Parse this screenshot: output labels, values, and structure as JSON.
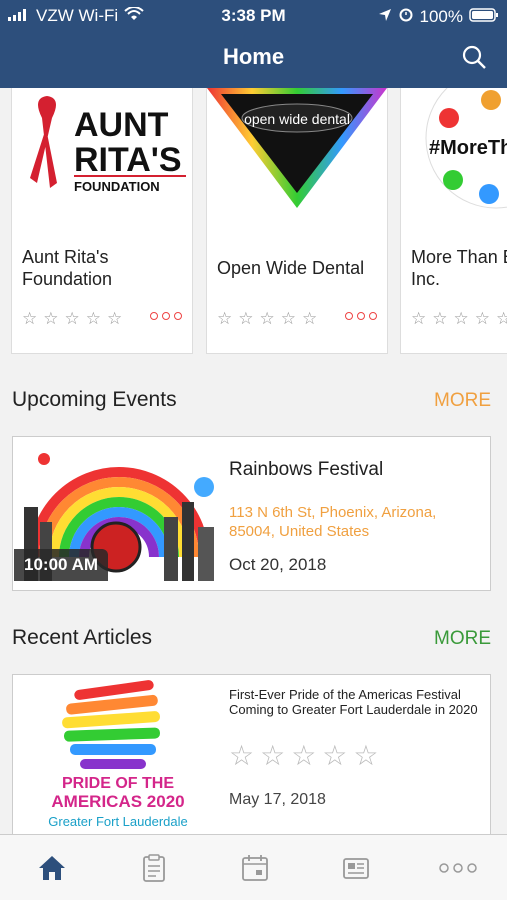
{
  "status_bar": {
    "carrier": "VZW Wi-Fi",
    "time": "3:38 PM",
    "battery": "100%"
  },
  "nav": {
    "title": "Home",
    "search_icon": "search-icon"
  },
  "organizations": [
    {
      "name": "Aunt Rita's Foundation",
      "logo_text_1": "AUNT",
      "logo_text_2": "RITA'S",
      "logo_text_3": "FOUNDATION",
      "stars": "☆☆☆☆☆"
    },
    {
      "name": "Open Wide Dental",
      "logo_text": "open wide dental",
      "stars": "☆☆☆☆☆"
    },
    {
      "name": "More Than Bars, Inc.",
      "logo_text": "#MoreTha",
      "stars": "☆☆☆☆☆"
    }
  ],
  "upcoming_events": {
    "heading": "Upcoming Events",
    "more_label": "MORE",
    "more_color": "#f0a040",
    "event": {
      "time": "10:00 AM",
      "title": "Rainbows Festival",
      "address": "113 N 6th St, Phoenix, Arizona, 85004, United States",
      "date": "Oct 20, 2018"
    }
  },
  "recent_articles": {
    "heading": "Recent Articles",
    "more_label": "MORE",
    "more_color": "#3a9a3a",
    "article": {
      "title": "First-Ever Pride of the Americas Festival Coming to Greater Fort Lauderdale in 2020",
      "stars": "☆☆☆☆☆",
      "date": "May 17, 2018",
      "logo_line_1": "PRIDE OF THE",
      "logo_line_2": "AMERICAS 2020",
      "logo_line_3": "Greater Fort Lauderdale"
    }
  },
  "tabbar": {
    "items": [
      "home-icon",
      "clipboard-icon",
      "calendar-icon",
      "newspaper-icon",
      "more-dots-icon"
    ],
    "active_color": "#2d4f7c"
  }
}
